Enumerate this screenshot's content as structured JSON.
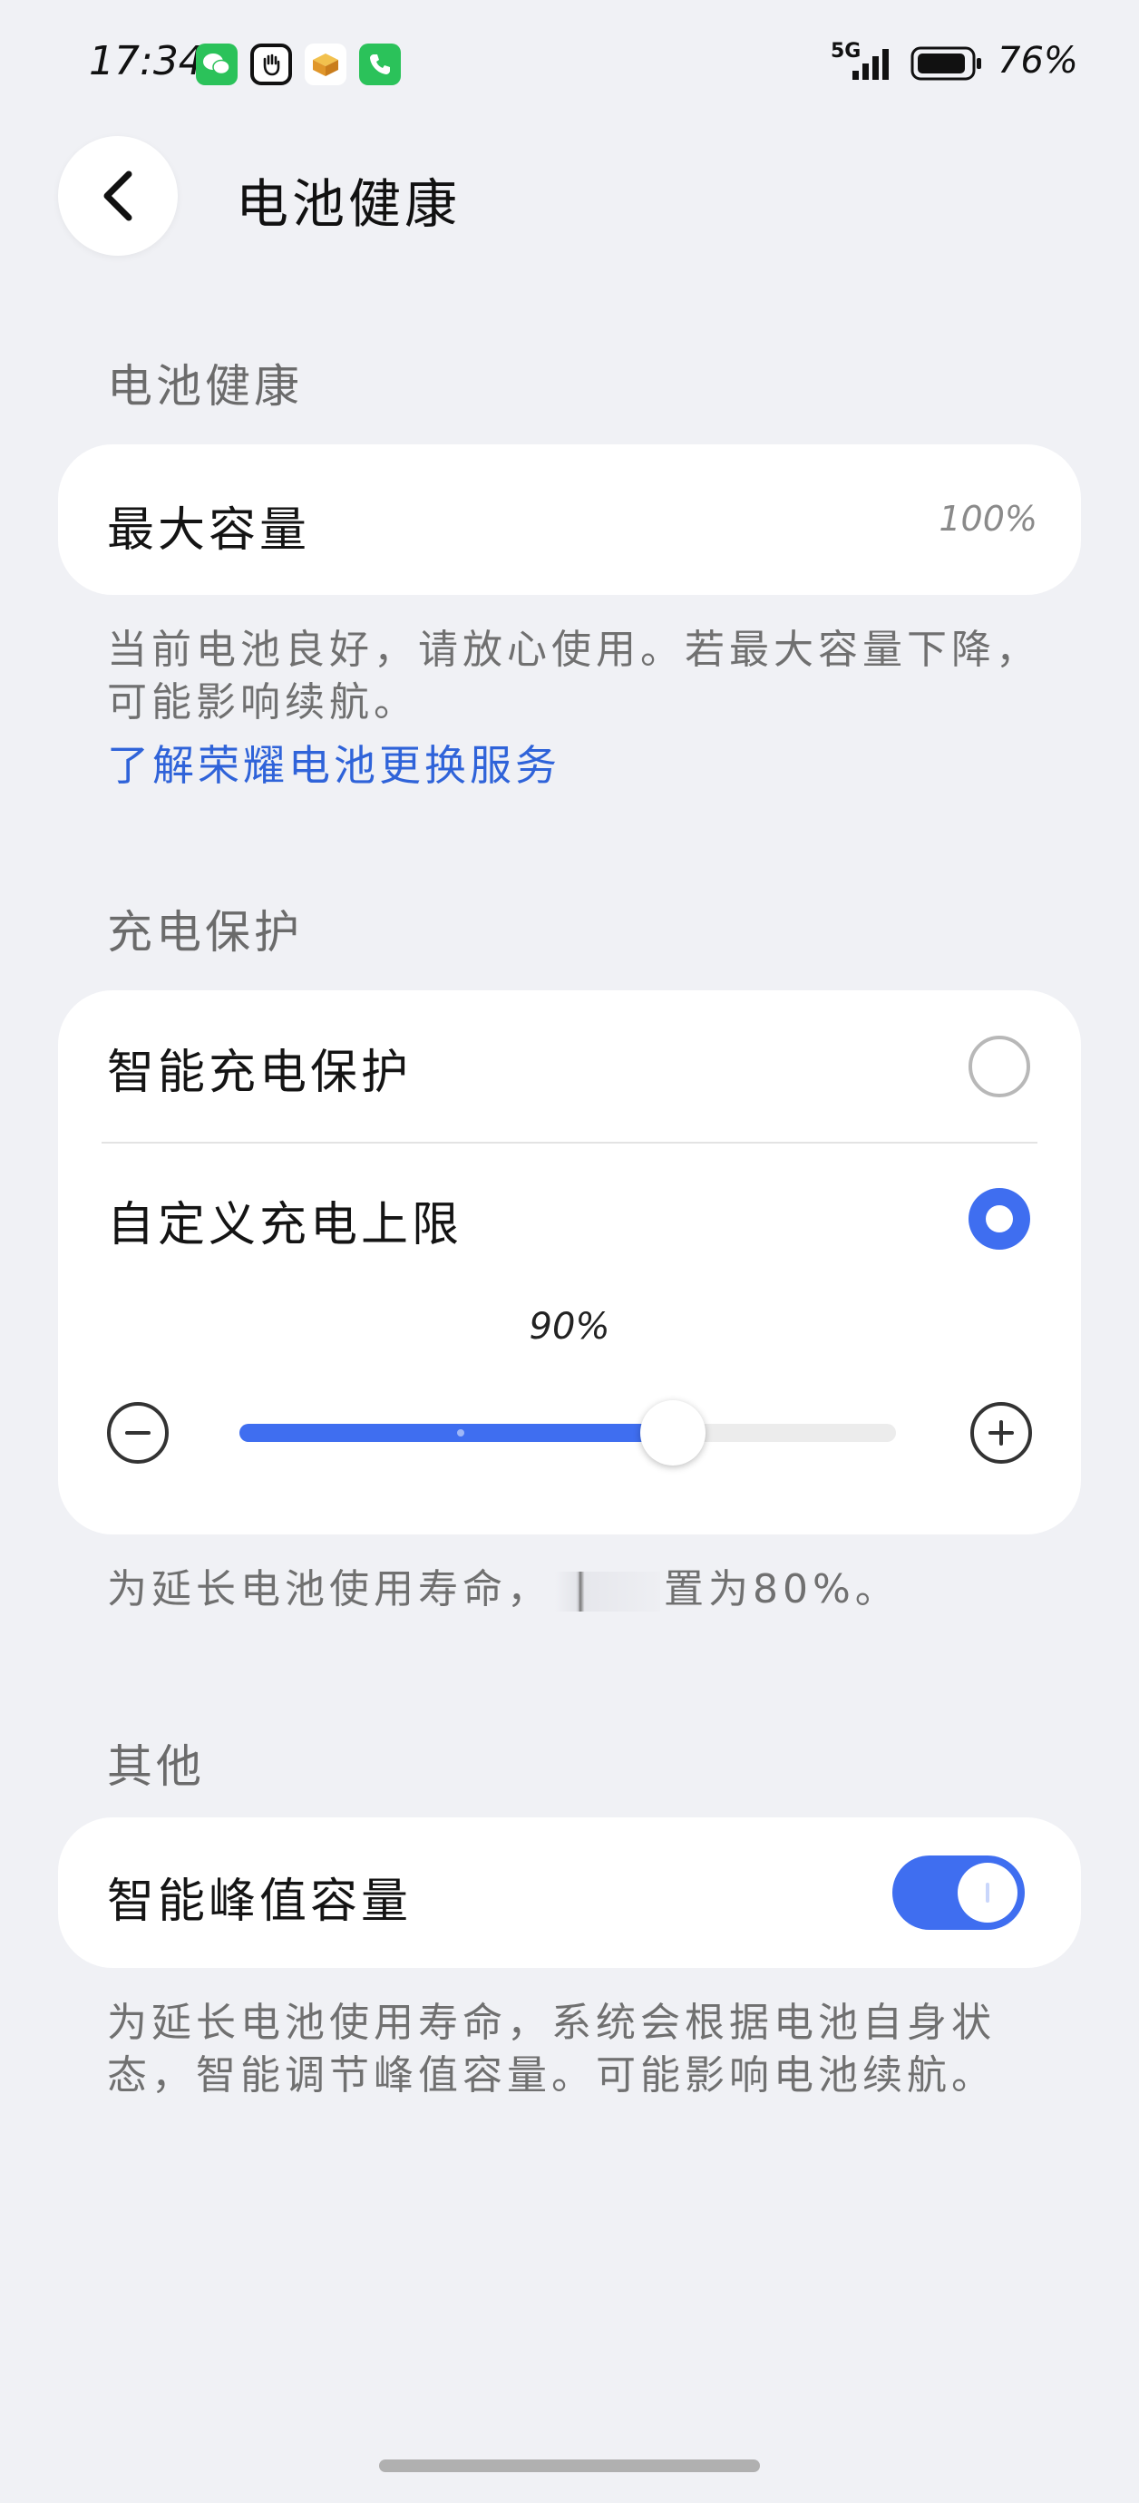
{
  "status_bar": {
    "time": "17:34",
    "network": "5G",
    "battery_percent": "76%",
    "app_icons": [
      "wechat-icon",
      "hand-icon",
      "box-icon",
      "phone-icon"
    ]
  },
  "header": {
    "title": "电池健康"
  },
  "sections": {
    "battery_health": {
      "title": "电池健康",
      "max_capacity_label": "最大容量",
      "max_capacity_value": "100%",
      "helper_text": "当前电池良好，请放心使用。若最大容量下降，可能影响续航。",
      "link_text": "了解荣耀电池更换服务"
    },
    "charging_protection": {
      "title": "充电保护",
      "smart_protection_label": "智能充电保护",
      "smart_protection_selected": false,
      "custom_limit_label": "自定义充电上限",
      "custom_limit_selected": true,
      "slider_value": "90%",
      "slider_fraction": 0.66,
      "helper_text_start": "为延长电池使用寿命，",
      "helper_text_end": "置为80%。"
    },
    "other": {
      "title": "其他",
      "peak_capacity_label": "智能峰值容量",
      "peak_capacity_enabled": true,
      "helper_text": "为延长电池使用寿命，系统会根据电池自身状态，智能调节峰值容量。可能影响电池续航。"
    }
  },
  "colors": {
    "background": "#f0f1f5",
    "card": "#ffffff",
    "accent": "#3f6ef0",
    "link": "#2f63d9",
    "secondary_text": "#707070"
  }
}
